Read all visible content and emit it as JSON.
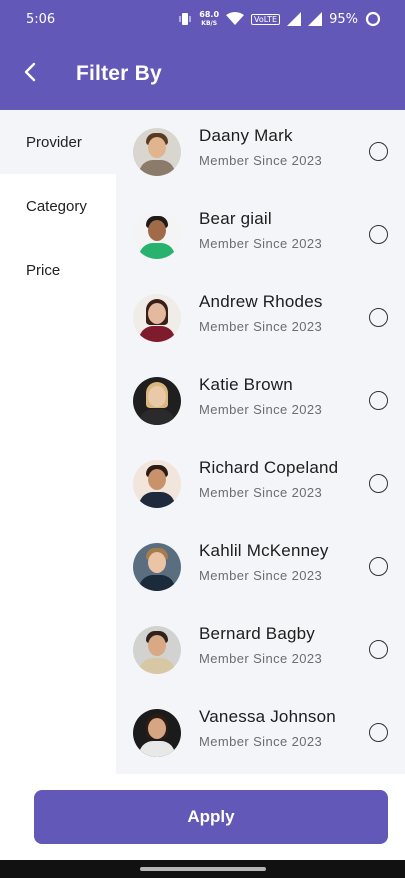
{
  "status_bar": {
    "time": "5:06",
    "net_speed_value": "68.0",
    "net_speed_unit": "KB/S",
    "volte": "VoLTE",
    "battery": "95%"
  },
  "header": {
    "title": "Filter By",
    "back_icon": "arrow-left-icon"
  },
  "sidebar": {
    "items": [
      {
        "label": "Provider",
        "active": true
      },
      {
        "label": "Category",
        "active": false
      },
      {
        "label": "Price",
        "active": false
      }
    ]
  },
  "providers": [
    {
      "name": "Daany Mark",
      "since": "Member Since 2023",
      "selected": false
    },
    {
      "name": "Bear giail",
      "since": "Member Since 2023",
      "selected": false
    },
    {
      "name": "Andrew Rhodes",
      "since": "Member Since 2023",
      "selected": false
    },
    {
      "name": "Katie Brown",
      "since": "Member Since 2023",
      "selected": false
    },
    {
      "name": "Richard Copeland",
      "since": "Member Since 2023",
      "selected": false
    },
    {
      "name": "Kahlil McKenney",
      "since": "Member Since 2023",
      "selected": false
    },
    {
      "name": "Bernard Bagby",
      "since": "Member Since 2023",
      "selected": false
    },
    {
      "name": "Vanessa Johnson",
      "since": "Member Since 2023",
      "selected": false
    }
  ],
  "footer": {
    "apply_label": "Apply"
  },
  "colors": {
    "primary": "#6258b8",
    "list_background": "#f3f5f8"
  }
}
